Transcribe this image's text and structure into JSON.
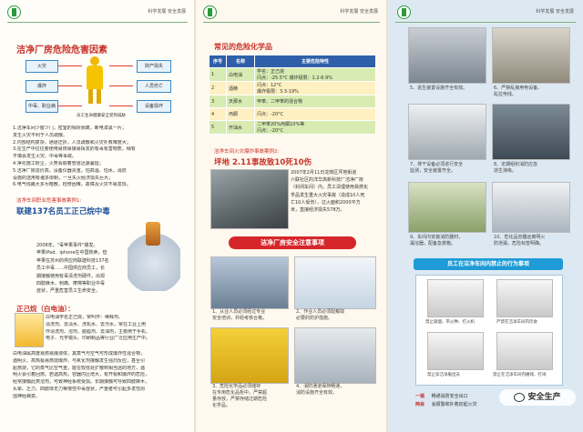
{
  "header": {
    "slogan": "科学发展   安全发展"
  },
  "panel1": {
    "title": "洁净厂房危险危害因素",
    "diagram": {
      "left": [
        "火灾",
        "爆炸",
        "中毒、职业病"
      ],
      "right": [
        "财产损失",
        "人员伤亡",
        "设备损坏"
      ],
      "caption": "员工生命健康安全受到威胁"
    },
    "hazards": [
      "1.洁净车间少窗少门，密室的相对隔离，断电漆黑一片；",
      "  发生火灾不利于人员疏散。",
      "2.内部结构复杂，通道迂折，人员疏散和火灾扑救难度大；",
      "3.在生产中往往要使用易燃易爆易挥发的有毒有害物质，稍有",
      "  不慎会发生火灾、中毒等事故。",
      "4.净化施工粉尘，火势会顺着管道迅速蔓延；",
      "5.洁净厂房造价高，设备仪器贵重，怕高温、怕水，消防",
      "  设施的选用有诸多限制，一旦失火经济损失巨大；",
      "6.电气线路大多为暗敷，检修困难，故障及火灾不易发现。"
    ],
    "case1_label": "洁净车间职业危害事故案例1:",
    "case1_title": "联建137名员工正己烷中毒",
    "case1_text": [
      "2008年，\"毒苹果事件\"爆发。",
      "苹果iPad、iphone在中国热卖，但",
      "苹果在苏州的供应商联建科技137名",
      "员工中毒……中国供应商员工，长",
      "期接触使用有毒清洗剂硬件，出现",
      "四肢麻木、刺痛、摩擦等职业中毒",
      "症状，严重危害员工生命安全。"
    ],
    "sub_title": "正己烷（白电油）：",
    "sub_text": [
      "白电油学名正己烷，常叫作：稀释剂、",
      "清洗剂、去渍水、洗机水、去污水，常在工业上用",
      "作清洗剂、溶剂、脱脂剂、去油剂，主要用于手机、",
      "电子、光学镜头、印刷制品等行业广泛应用生产中。",
      "白电油属高度易燃易爆液体，其蒸气与空气可形成爆炸性混合物，",
      "遇明火、高热极易燃烧爆炸。与氧化剂接触发生强烈反应，甚至引",
      "起燃烧，它的蒸气比空气重，能在较低处扩散到相当远的地方，遇",
      "明火会引着回燃。若遇高热，容器内压增大，有开裂和爆炸的危险，",
      "经常接触此类溶剂，可致神经系统受损。长期接触可导致四肢麻木，",
      "头晕、乏力、四肢体无力等慢性中毒症状，严重者可引起多发性周",
      "围神经病变。"
    ]
  },
  "panel2": {
    "chem_title": "常见的危险化学品",
    "table_head": [
      "序号",
      "名称",
      "主要危险特性"
    ],
    "table_rows": [
      {
        "no": "1",
        "name": "白电油",
        "lines": [
          "学名：正己烷",
          "闪点：-25.5°C  爆炸极限：1.2-6.9%"
        ]
      },
      {
        "no": "2",
        "name": "酒精",
        "lines": [
          "闪点：12°C",
          "爆炸极限：3.3-19%"
        ]
      },
      {
        "no": "3",
        "name": "天那水",
        "lines": [
          "甲苯、二甲苯的混合物"
        ]
      },
      {
        "no": "4",
        "name": "丙酮",
        "lines": [
          "闪点：-20°C"
        ]
      },
      {
        "no": "5",
        "name": "开油水",
        "lines": [
          "二甲苯20%丙酮10%等",
          "闪点：-20°C"
        ]
      }
    ],
    "case2_label": "洁净车间火灾爆炸事故案例2:",
    "case2_title": "坪地 2.11事故致10死10伤",
    "case2_text": [
      "2007年2月11日龙岗区坪地街道",
      "六联社区的洋华高新科技厂洁净厂房",
      "（封闭车间）内，员工清理使用易燃化",
      "学品发生重大火灾事故（造成10人死",
      "亡10人受伤），过火面积2000平方",
      "米，直接经济损失578万。"
    ],
    "notice_title": "洁净厂房安全注意事项",
    "tips": [
      [
        "1、从业人员必须经过专业",
        "安全培训，并经考核合格。"
      ],
      [
        "2、作业人员必须配戴取",
        "必要的防护措施。"
      ],
      [
        "3、危险化学品必须储存",
        "在专用危化品柜中，严禁超",
        "量存放，严禁存储过期危险",
        "化学品。"
      ],
      [
        "4、消防通道保持畅通，",
        "消防设施齐全有效。"
      ]
    ]
  },
  "panel3": {
    "tips": [
      [
        "5、逃生装置设施齐全有效。"
      ],
      [
        "6、严禁乱接用电设备、",
        "乱拉电线。"
      ],
      [
        "7、排干设备必须进行安全",
        "监测，安全装置齐全。"
      ],
      [
        "8、定期组织消防应急",
        "逃生演练。"
      ],
      [
        "9、车间内安装消防器材，",
        "漏溶器，配备急救箱。"
      ],
      [
        "10、危化品容器远离明火",
        "防泄漏，危险标签明确。"
      ]
    ],
    "forbid_title": "员工在洁净车间内禁止的行为事项",
    "forbid_caps": [
      "禁止吸烟、带火种、打火机",
      "严禁在洁净车间内饮食",
      "禁止穿洁净服出去",
      "禁止在洁净车间内嬉戏、打闹"
    ],
    "bottom": [
      {
        "k": "一锁",
        "v": "畅通消防安全出口"
      },
      {
        "k": "两会",
        "v": "会报警和扑救初起火灾"
      }
    ],
    "watermark": "安全生产"
  }
}
